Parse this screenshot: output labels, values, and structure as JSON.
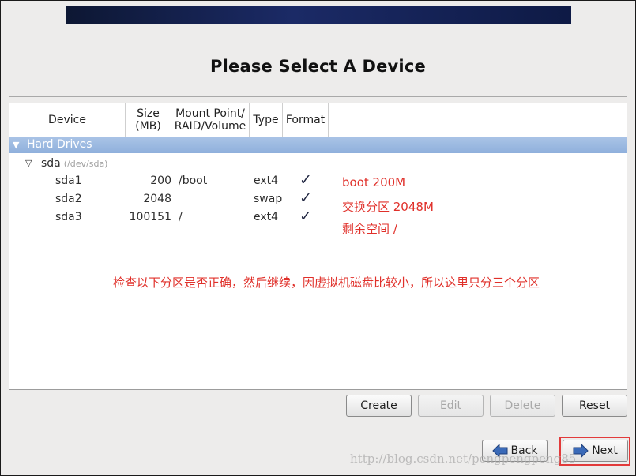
{
  "page": {
    "title": "Please Select A Device"
  },
  "table": {
    "columns": {
      "device": "Device",
      "size_line1": "Size",
      "size_line2": "(MB)",
      "mount_line1": "Mount Point/",
      "mount_line2": "RAID/Volume",
      "type": "Type",
      "format": "Format"
    },
    "group": {
      "label": "Hard Drives"
    },
    "disk": {
      "name": "sda",
      "path": "(/dev/sda)"
    },
    "partitions": [
      {
        "device": "sda1",
        "size": "200",
        "mount": "/boot",
        "type": "ext4",
        "format": "✓"
      },
      {
        "device": "sda2",
        "size": "2048",
        "mount": "",
        "type": "swap",
        "format": "✓"
      },
      {
        "device": "sda3",
        "size": "100151",
        "mount": "/",
        "type": "ext4",
        "format": "✓"
      }
    ]
  },
  "annotations": {
    "notes": [
      "boot 200M",
      "交换分区 2048M",
      "剩余空间 /"
    ],
    "hint": "检查以下分区是否正确，然后继续，因虚拟机磁盘比较小，所以这里只分三个分区",
    "color": "#e0302a"
  },
  "actions": {
    "create": "Create",
    "edit": "Edit",
    "delete": "Delete",
    "reset": "Reset"
  },
  "nav": {
    "back": "Back",
    "next": "Next"
  },
  "watermark": "http://blog.csdn.net/pengpengpeng85",
  "colors": {
    "selection": "#98b6e0",
    "banner": "#101c46",
    "highlight": "#e23a3a"
  }
}
